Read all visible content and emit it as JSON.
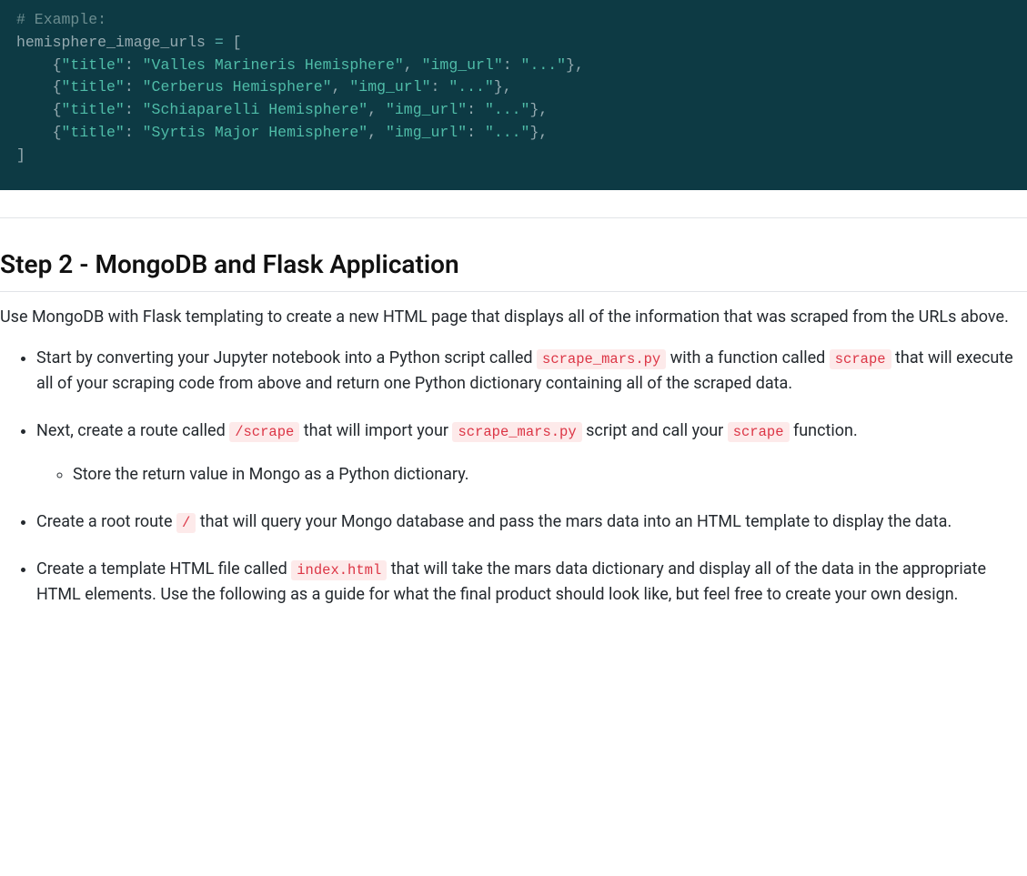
{
  "code": {
    "comment": "# Example:",
    "var_name": "hemisphere_image_urls",
    "assign_op": "=",
    "open_bracket": "[",
    "close_bracket": "]",
    "entries": [
      {
        "title_key": "\"title\"",
        "title_val": "\"Valles Marineris Hemisphere\"",
        "url_key": "\"img_url\"",
        "url_val": "\"...\""
      },
      {
        "title_key": "\"title\"",
        "title_val": "\"Cerberus Hemisphere\"",
        "url_key": "\"img_url\"",
        "url_val": "\"...\""
      },
      {
        "title_key": "\"title\"",
        "title_val": "\"Schiaparelli Hemisphere\"",
        "url_key": "\"img_url\"",
        "url_val": "\"...\""
      },
      {
        "title_key": "\"title\"",
        "title_val": "\"Syrtis Major Hemisphere\"",
        "url_key": "\"img_url\"",
        "url_val": "\"...\""
      }
    ]
  },
  "heading": "Step 2 - MongoDB and Flask Application",
  "intro": "Use MongoDB with Flask templating to create a new HTML page that displays all of the information that was scraped from the URLs above.",
  "bullets": {
    "b1": {
      "pre1": "Start by converting your Jupyter notebook into a Python script called ",
      "code1": "scrape_mars.py",
      "mid1": " with a function called ",
      "code2": "scrape",
      "post1": " that will execute all of your scraping code from above and return one Python dictionary containing all of the scraped data."
    },
    "b2": {
      "pre1": "Next, create a route called ",
      "code1": "/scrape",
      "mid1": " that will import your ",
      "code2": "scrape_mars.py",
      "mid2": " script and call your ",
      "code3": "scrape",
      "post1": " function.",
      "sub1": "Store the return value in Mongo as a Python dictionary."
    },
    "b3": {
      "pre1": "Create a root route ",
      "code1": "/",
      "post1": " that will query your Mongo database and pass the mars data into an HTML template to display the data."
    },
    "b4": {
      "pre1": "Create a template HTML file called ",
      "code1": "index.html",
      "post1": " that will take the mars data dictionary and display all of the data in the appropriate HTML elements. Use the following as a guide for what the final product should look like, but feel free to create your own design."
    }
  }
}
